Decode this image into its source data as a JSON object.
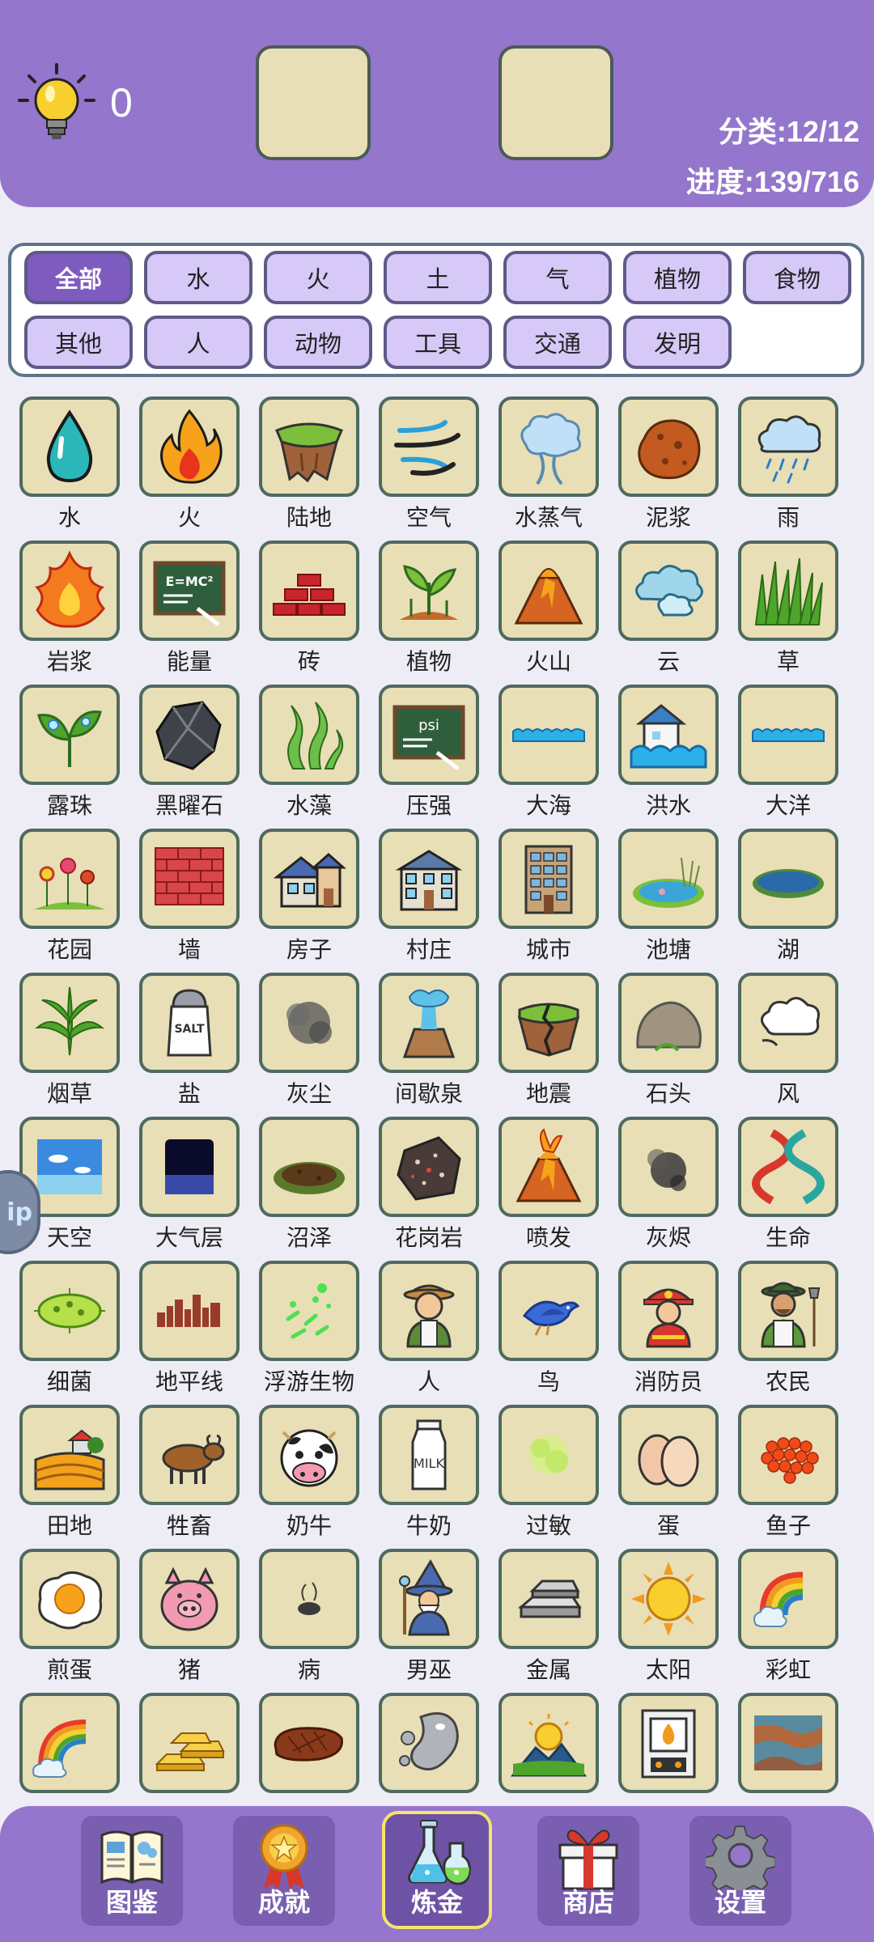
{
  "header": {
    "hint_count": "0",
    "category_progress": "分类:12/12",
    "total_progress": "进度:139/716"
  },
  "categories": [
    {
      "label": "全部",
      "active": true
    },
    {
      "label": "水"
    },
    {
      "label": "火"
    },
    {
      "label": "土"
    },
    {
      "label": "气"
    },
    {
      "label": "植物"
    },
    {
      "label": "食物"
    },
    {
      "label": "其他"
    },
    {
      "label": "人"
    },
    {
      "label": "动物"
    },
    {
      "label": "工具"
    },
    {
      "label": "交通"
    },
    {
      "label": "发明"
    }
  ],
  "elements": [
    {
      "label": "水",
      "icon": "water-drop-icon"
    },
    {
      "label": "火",
      "icon": "fire-icon"
    },
    {
      "label": "陆地",
      "icon": "land-icon"
    },
    {
      "label": "空气",
      "icon": "wind-air-icon"
    },
    {
      "label": "水蒸气",
      "icon": "steam-icon"
    },
    {
      "label": "泥浆",
      "icon": "mud-icon"
    },
    {
      "label": "雨",
      "icon": "rain-cloud-icon"
    },
    {
      "label": "岩浆",
      "icon": "lava-icon"
    },
    {
      "label": "能量",
      "icon": "energy-chalkboard-icon"
    },
    {
      "label": "砖",
      "icon": "brick-icon"
    },
    {
      "label": "植物",
      "icon": "plant-icon"
    },
    {
      "label": "火山",
      "icon": "volcano-icon"
    },
    {
      "label": "云",
      "icon": "cloud-icon"
    },
    {
      "label": "草",
      "icon": "grass-icon"
    },
    {
      "label": "露珠",
      "icon": "dew-icon"
    },
    {
      "label": "黑曜石",
      "icon": "obsidian-icon"
    },
    {
      "label": "水藻",
      "icon": "algae-icon"
    },
    {
      "label": "压强",
      "icon": "pressure-chalkboard-icon"
    },
    {
      "label": "大海",
      "icon": "sea-icon"
    },
    {
      "label": "洪水",
      "icon": "flood-icon"
    },
    {
      "label": "大洋",
      "icon": "ocean-icon"
    },
    {
      "label": "花园",
      "icon": "garden-icon"
    },
    {
      "label": "墙",
      "icon": "wall-icon"
    },
    {
      "label": "房子",
      "icon": "house-icon"
    },
    {
      "label": "村庄",
      "icon": "village-icon"
    },
    {
      "label": "城市",
      "icon": "city-icon"
    },
    {
      "label": "池塘",
      "icon": "pond-icon"
    },
    {
      "label": "湖",
      "icon": "lake-icon"
    },
    {
      "label": "烟草",
      "icon": "tobacco-leaf-icon"
    },
    {
      "label": "盐",
      "icon": "salt-shaker-icon"
    },
    {
      "label": "灰尘",
      "icon": "dust-icon"
    },
    {
      "label": "间歇泉",
      "icon": "geyser-icon"
    },
    {
      "label": "地震",
      "icon": "earthquake-icon"
    },
    {
      "label": "石头",
      "icon": "stone-icon"
    },
    {
      "label": "风",
      "icon": "wind-icon"
    },
    {
      "label": "天空",
      "icon": "sky-icon"
    },
    {
      "label": "大气层",
      "icon": "atmosphere-icon"
    },
    {
      "label": "沼泽",
      "icon": "swamp-icon"
    },
    {
      "label": "花岗岩",
      "icon": "granite-icon"
    },
    {
      "label": "喷发",
      "icon": "eruption-icon"
    },
    {
      "label": "灰烬",
      "icon": "ash-icon"
    },
    {
      "label": "生命",
      "icon": "dna-icon"
    },
    {
      "label": "细菌",
      "icon": "bacteria-icon"
    },
    {
      "label": "地平线",
      "icon": "horizon-skyline-icon"
    },
    {
      "label": "浮游生物",
      "icon": "plankton-icon"
    },
    {
      "label": "人",
      "icon": "human-icon"
    },
    {
      "label": "鸟",
      "icon": "bird-icon"
    },
    {
      "label": "消防员",
      "icon": "firefighter-icon"
    },
    {
      "label": "农民",
      "icon": "farmer-icon"
    },
    {
      "label": "田地",
      "icon": "field-icon"
    },
    {
      "label": "牲畜",
      "icon": "livestock-icon"
    },
    {
      "label": "奶牛",
      "icon": "cow-icon"
    },
    {
      "label": "牛奶",
      "icon": "milk-bottle-icon"
    },
    {
      "label": "过敏",
      "icon": "allergy-icon"
    },
    {
      "label": "蛋",
      "icon": "egg-icon"
    },
    {
      "label": "鱼子",
      "icon": "roe-icon"
    },
    {
      "label": "煎蛋",
      "icon": "fried-egg-icon"
    },
    {
      "label": "猪",
      "icon": "pig-icon"
    },
    {
      "label": "病",
      "icon": "sickness-icon"
    },
    {
      "label": "男巫",
      "icon": "wizard-icon"
    },
    {
      "label": "金属",
      "icon": "metal-ingot-icon"
    },
    {
      "label": "太阳",
      "icon": "sun-icon"
    },
    {
      "label": "彩虹",
      "icon": "rainbow-icon"
    },
    {
      "label": "",
      "icon": "double-rainbow-icon"
    },
    {
      "label": "",
      "icon": "gold-bars-icon"
    },
    {
      "label": "",
      "icon": "steak-icon"
    },
    {
      "label": "",
      "icon": "mercury-drops-icon"
    },
    {
      "label": "",
      "icon": "sunrise-mountain-icon"
    },
    {
      "label": "",
      "icon": "furnace-icon"
    },
    {
      "label": "",
      "icon": "rust-icon"
    }
  ],
  "side_tab": {
    "label": "ip"
  },
  "nav": [
    {
      "label": "图鉴",
      "icon": "encyclopedia-book-icon"
    },
    {
      "label": "成就",
      "icon": "achievement-medal-icon"
    },
    {
      "label": "炼金",
      "icon": "alchemy-flask-icon",
      "active": true
    },
    {
      "label": "商店",
      "icon": "shop-gift-icon"
    },
    {
      "label": "设置",
      "icon": "settings-gear-icon"
    }
  ],
  "colors": {
    "header_bg": "#9476cc",
    "tile_bg": "#e8dfb6",
    "chip_bg": "#d6c8f7",
    "chip_active_bg": "#7e5cbf",
    "nav_active_border": "#f5e56a"
  }
}
